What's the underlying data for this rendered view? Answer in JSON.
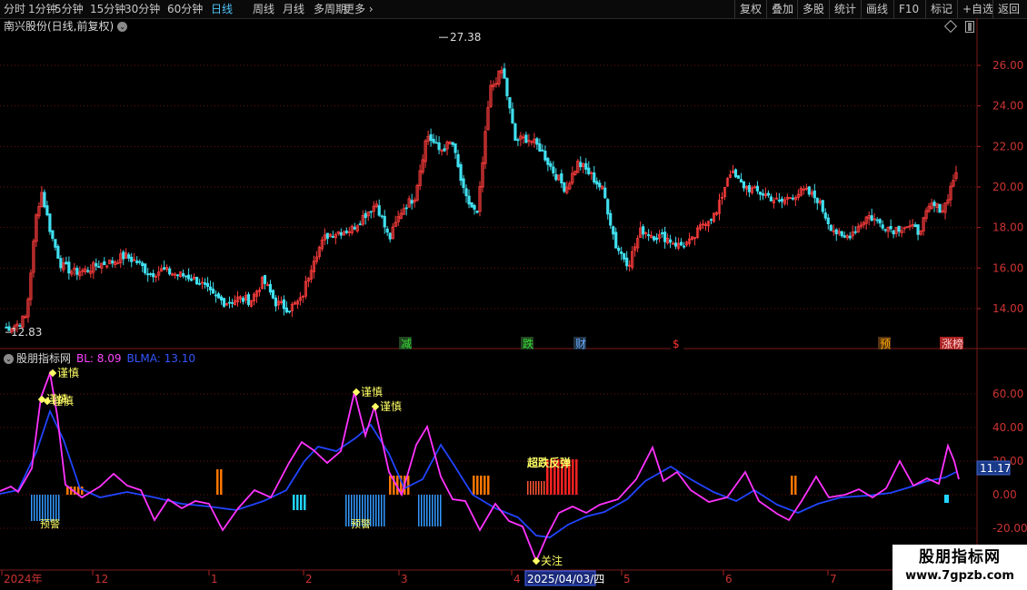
{
  "toolbar": {
    "left_items": [
      {
        "label": "分时",
        "active": false
      },
      {
        "label": "1分钟",
        "active": false
      },
      {
        "label": "5分钟",
        "active": false
      },
      {
        "label": "15分钟",
        "active": false
      },
      {
        "label": "30分钟",
        "active": false
      },
      {
        "label": "60分钟",
        "active": false
      },
      {
        "label": "日线",
        "active": true
      },
      {
        "label": "周线",
        "active": false
      },
      {
        "label": "月线",
        "active": false
      },
      {
        "label": "多周期",
        "active": false
      },
      {
        "label": "更多",
        "active": false
      }
    ],
    "right_items": [
      "复权",
      "叠加",
      "多股",
      "统计",
      "画线",
      "F10",
      "标记",
      "+自选",
      "返回"
    ]
  },
  "main": {
    "title": "南兴股份(日线,前复权)",
    "high_label": "27.38",
    "low_label": "12.83",
    "y_labels": [
      "26.00",
      "24.00",
      "22.00",
      "20.00",
      "18.00",
      "16.00",
      "14.00"
    ],
    "y_values": [
      26,
      24,
      22,
      20,
      18,
      16,
      14
    ],
    "events": [
      {
        "text": "减",
        "color": "#33dd33",
        "bg": "#224422"
      },
      {
        "text": "跌",
        "color": "#33dd33",
        "bg": "#224422"
      },
      {
        "text": "财",
        "color": "#66aaff",
        "bg": "#223344"
      },
      {
        "text": "$",
        "color": "#ff3333",
        "bg": "#000000"
      },
      {
        "text": "预",
        "color": "#ffaa00",
        "bg": "#553311"
      },
      {
        "text": "涨榜",
        "color": "#ffcccc",
        "bg": "#aa2222"
      }
    ]
  },
  "indicator": {
    "name": "股朋指标网",
    "bl_text": "BL: 8.09",
    "blma_text": "BLMA: 13.10",
    "current_value": "11.17",
    "y_labels": [
      "60.00",
      "40.00",
      "20.00",
      "0.00",
      "-20.00"
    ],
    "y_values": [
      60,
      40,
      20,
      0,
      -20
    ],
    "annotations": [
      "谨慎",
      "谨慎",
      "谨慎",
      "谨慎",
      "谨慎",
      "关注"
    ],
    "signal_text": "超跌反弹",
    "bottom_labels": [
      "预警",
      "预警"
    ]
  },
  "time_axis": {
    "labels": [
      "2024年",
      "12",
      "1",
      "2",
      "3",
      "4",
      "2025/04/03/四",
      "5",
      "6",
      "7"
    ]
  },
  "watermark": {
    "title": "股朋指标网",
    "url": "www.7gpzb.com"
  },
  "colors": {
    "up": "#ff3d3d",
    "down": "#40e0f0",
    "bl_line": "#ff33ff",
    "blma_line": "#2244ff",
    "grid": "#6a1010",
    "warn_bar": "#3399ff",
    "orange_bar": "#ff7700",
    "red_bar": "#ff2222",
    "label_yellow": "#ffff66"
  }
}
